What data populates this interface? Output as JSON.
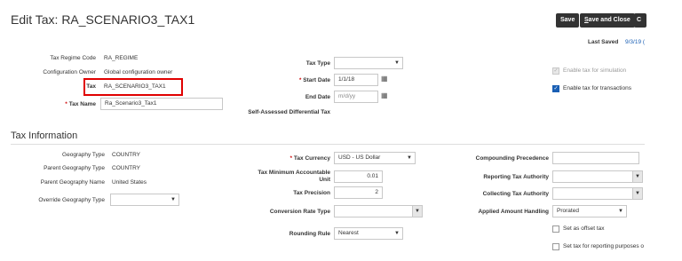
{
  "header": {
    "title": "Edit Tax: RA_SCENARIO3_TAX1",
    "save_label": "Save",
    "save_close_label_pre": "S",
    "save_close_label_post": "ave and Close",
    "cancel_partial": "C",
    "last_saved_label": "Last Saved",
    "last_saved_value": "9/3/19 ("
  },
  "main": {
    "tax_regime_code_label": "Tax Regime Code",
    "tax_regime_code_value": "RA_REGIME",
    "config_owner_label": "Configuration Owner",
    "config_owner_value": "Global configuration owner",
    "tax_label": "Tax",
    "tax_value": "RA_SCENARIO3_TAX1",
    "tax_name_label": "Tax Name",
    "tax_name_value": "Ra_Scenario3_Tax1",
    "tax_type_label": "Tax Type",
    "tax_type_value": "",
    "start_date_label": "Start Date",
    "start_date_value": "1/1/18",
    "end_date_label": "End Date",
    "end_date_placeholder": "m/d/yy",
    "self_assessed_label": "Self-Assessed Differential Tax",
    "enable_simulation_label": "Enable tax for simulation",
    "enable_simulation_checked": true,
    "enable_transactions_label": "Enable tax for transactions",
    "enable_transactions_checked": true
  },
  "tax_info": {
    "section_title": "Tax Information",
    "geography_type_label": "Geography Type",
    "geography_type_value": "COUNTRY",
    "parent_geo_type_label": "Parent Geography Type",
    "parent_geo_type_value": "COUNTRY",
    "parent_geo_name_label": "Parent Geography Name",
    "parent_geo_name_value": "United States",
    "override_geo_type_label": "Override Geography Type",
    "override_geo_type_value": "",
    "tax_currency_label": "Tax Currency",
    "tax_currency_value": "USD - US Dollar",
    "tax_min_acct_unit_label_1": "Tax Minimum Accountable",
    "tax_min_acct_unit_label_2": "Unit",
    "tax_min_acct_unit_value": "0.01",
    "tax_precision_label": "Tax Precision",
    "tax_precision_value": "2",
    "conversion_rate_type_label": "Conversion Rate Type",
    "conversion_rate_type_value": "",
    "rounding_rule_label": "Rounding Rule",
    "rounding_rule_value": "Nearest",
    "compounding_precedence_label": "Compounding Precedence",
    "compounding_precedence_value": "",
    "reporting_tax_authority_label": "Reporting Tax Authority",
    "reporting_tax_authority_value": "",
    "collecting_tax_authority_label": "Collecting Tax Authority",
    "collecting_tax_authority_value": "",
    "applied_amount_handling_label": "Applied Amount Handling",
    "applied_amount_handling_value": "Prorated",
    "set_offset_label": "Set as offset tax",
    "set_reporting_label": "Set tax for reporting purposes o"
  },
  "icons": {
    "dropdown": "chevron-down-icon",
    "calendar": "calendar-icon",
    "check": "check-icon"
  },
  "colors": {
    "highlight": "#e00000",
    "button_bg": "#333333",
    "checkbox_on": "#1a5fb4"
  }
}
